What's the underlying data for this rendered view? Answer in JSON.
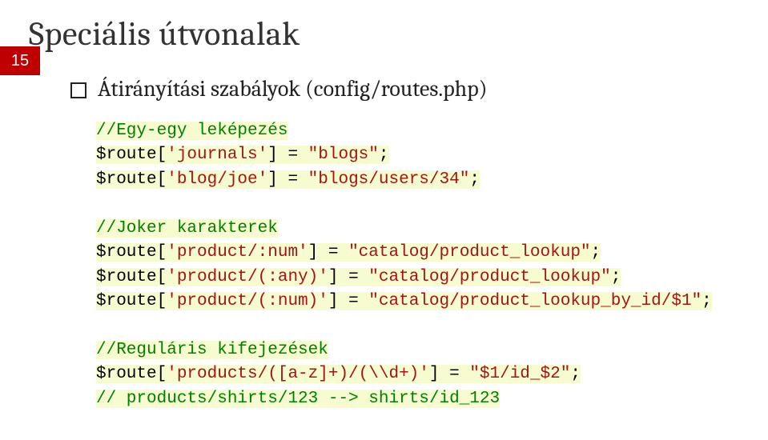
{
  "pageNumber": "15",
  "title": "Speciális útvonalak",
  "bullet": "Átirányítási szabályok (config/routes.php)",
  "code": {
    "c1": "//Egy-egy leképezés",
    "l2a": "$route[",
    "l2b": "'journals'",
    "l2c": "] = ",
    "l2d": "\"blogs\"",
    "l2e": ";",
    "l3a": "$route[",
    "l3b": "'blog/joe'",
    "l3c": "] = ",
    "l3d": "\"blogs/users/34\"",
    "l3e": ";",
    "c4": "//Joker karakterek",
    "l5a": "$route[",
    "l5b": "'product/:num'",
    "l5c": "] = ",
    "l5d": "\"catalog/product_lookup\"",
    "l5e": ";",
    "l6a": "$route[",
    "l6b": "'product/(:any)'",
    "l6c": "] = ",
    "l6d": "\"catalog/product_lookup\"",
    "l6e": ";",
    "l7a": "$route[",
    "l7b": "'product/(:num)'",
    "l7c": "] = ",
    "l7d": "\"catalog/product_lookup_by_id/$1\"",
    "l7e": ";",
    "c8": "//Reguláris kifejezések",
    "l9a": "$route[",
    "l9b": "'products/([a-z]+)/(\\\\d+)'",
    "l9c": "] = ",
    "l9d": "\"$1/id_$2\"",
    "l9e": ";",
    "c10": "// products/shirts/123 --> shirts/id_123"
  }
}
